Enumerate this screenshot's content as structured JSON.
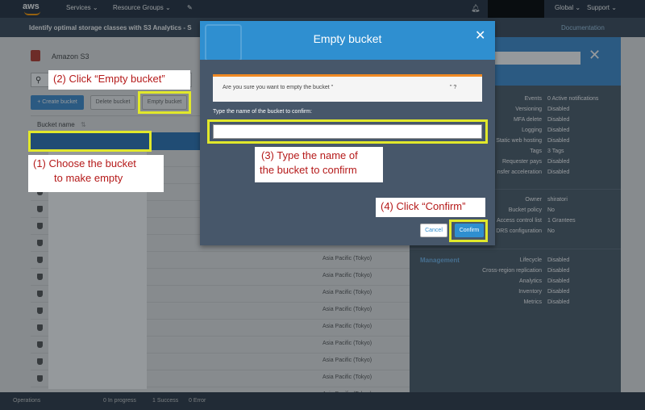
{
  "nav": {
    "logo": "aws",
    "services": "Services",
    "resource_groups": "Resource Groups",
    "global": "Global",
    "support": "Support"
  },
  "subheader": {
    "title": "Identify optimal storage classes with S3 Analytics - S",
    "documentation": "Documentation"
  },
  "main": {
    "service_label": "Amazon S3",
    "create_bucket": "+ Create bucket",
    "delete_bucket": "Delete bucket",
    "empty_bucket": "Empty bucket",
    "column_header": "Bucket name",
    "rows": [
      {
        "region": ""
      },
      {
        "region": ""
      },
      {
        "region": ""
      },
      {
        "region": ""
      },
      {
        "region": ""
      },
      {
        "region": ""
      },
      {
        "region": "Asia Pacific (Tokyo)"
      },
      {
        "region": "Asia Pacific (Tokyo)"
      },
      {
        "region": "Asia Pacific (Tokyo)"
      },
      {
        "region": "Asia Pacific (Tokyo)"
      },
      {
        "region": "Asia Pacific (Tokyo)"
      },
      {
        "region": "Asia Pacific (Tokyo)"
      },
      {
        "region": "Asia Pacific (Tokyo)"
      },
      {
        "region": "Asia Pacific (Tokyo)"
      },
      {
        "region": "Asia Pacific (Tokyo)"
      }
    ]
  },
  "right_panel": {
    "properties": [
      {
        "key": "Events",
        "value": "0 Active notifications"
      },
      {
        "key": "Versioning",
        "value": "Disabled"
      },
      {
        "key": "MFA delete",
        "value": "Disabled"
      },
      {
        "key": "Logging",
        "value": "Disabled"
      },
      {
        "key": "Static web hosting",
        "value": "Disabled"
      },
      {
        "key": "Tags",
        "value": "3 Tags"
      },
      {
        "key": "Requester pays",
        "value": "Disabled"
      },
      {
        "key": "nsfer acceleration",
        "value": "Disabled"
      }
    ],
    "permissions": [
      {
        "key": "Owner",
        "value": "shiratori"
      },
      {
        "key": "Bucket policy",
        "value": "No"
      },
      {
        "key": "Access control list",
        "value": "1 Grantees"
      },
      {
        "key": "DRS configuration",
        "value": "No"
      }
    ],
    "management_title": "Management",
    "management": [
      {
        "key": "Lifecycle",
        "value": "Disabled"
      },
      {
        "key": "Cross-region replication",
        "value": "Disabled"
      },
      {
        "key": "Analytics",
        "value": "Disabled"
      },
      {
        "key": "Inventory",
        "value": "Disabled"
      },
      {
        "key": "Metrics",
        "value": "Disabled"
      }
    ]
  },
  "bottombar": {
    "operations": "Operations",
    "in_progress": "0 In progress",
    "success": "1 Success",
    "error": "0 Error"
  },
  "modal": {
    "title": "Empty bucket",
    "warning_prefix": "Are you sure you want to empty the bucket \"",
    "warning_suffix": "\" ?",
    "type_label": "Type the name of the bucket to confirm:",
    "confirm_value": "",
    "cancel": "Cancel",
    "confirm": "Confirm"
  },
  "callouts": {
    "step1_line1": "(1) Choose the bucket",
    "step1_line2": "to make empty",
    "step2": "(2) Click “Empty bucket”",
    "step3_line1": "(3) Type the name of",
    "step3_line2": "the bucket to confirm",
    "step4": "(4) Click “Confirm”"
  },
  "colors": {
    "nav_bg": "#232f3e",
    "accent_blue": "#2f8fd0",
    "highlight_yellow": "#e1e82b",
    "callout_red": "#b51a1a"
  }
}
